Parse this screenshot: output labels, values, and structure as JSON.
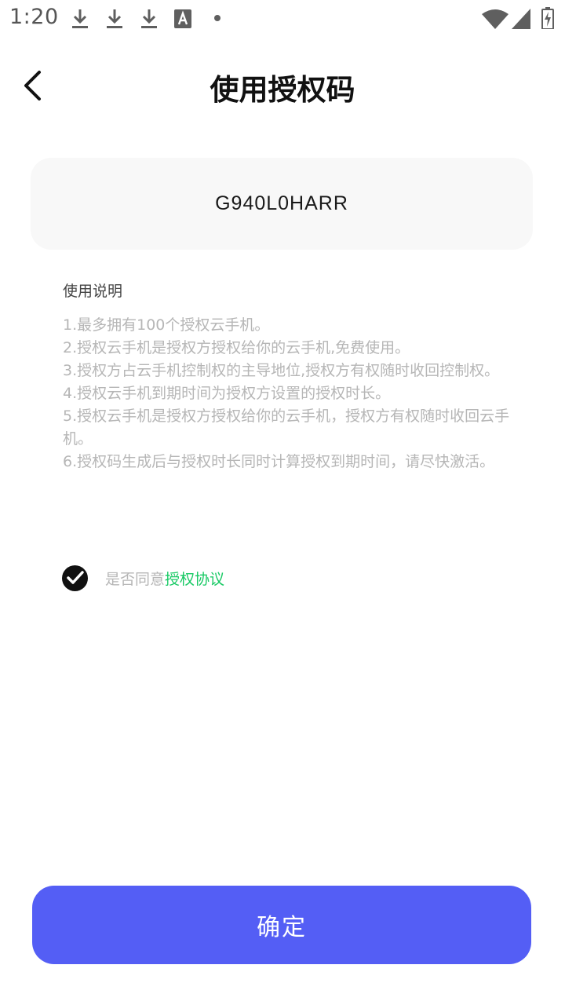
{
  "status_bar": {
    "time": "1:20",
    "icons": [
      "download-icon",
      "download-icon",
      "download-icon",
      "a-text-icon",
      "dot-icon",
      "wifi-icon",
      "signal-icon",
      "battery-charging-icon"
    ]
  },
  "header": {
    "back_icon": "chevron-left-icon",
    "title": "使用授权码"
  },
  "code": {
    "value": "G940L0HARR"
  },
  "instructions": {
    "title": "使用说明",
    "items": [
      "1.最多拥有100个授权云手机。",
      "2.授权云手机是授权方授权给你的云手机,免费使用。",
      "3.授权方占云手机控制权的主导地位,授权方有权随时收回控制权。",
      "4.授权云手机到期时间为授权方设置的授权时长。",
      "5.授权云手机是授权方授权给你的云手机，授权方有权随时收回云手机。",
      "6.授权码生成后与授权时长同时计算授权到期时间，请尽快激活。"
    ]
  },
  "agreement": {
    "checked": true,
    "prefix": "是否同意",
    "link": "授权协议",
    "link_color": "#18c964"
  },
  "confirm": {
    "label": "确定",
    "color": "#545ef5"
  }
}
